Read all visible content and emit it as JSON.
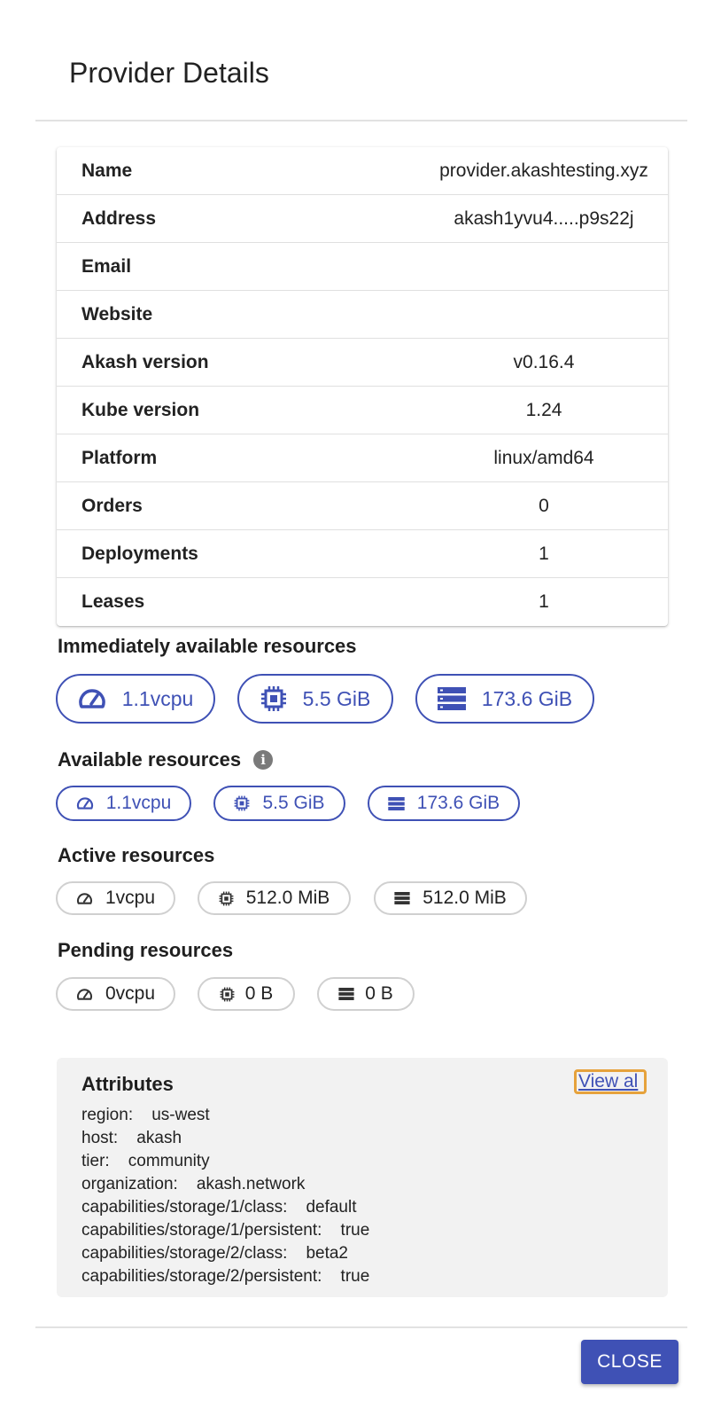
{
  "dialog": {
    "title": "Provider Details",
    "close_label": "CLOSE"
  },
  "info_rows": [
    {
      "label": "Name",
      "value": "provider.akashtesting.xyz"
    },
    {
      "label": "Address",
      "value": "akash1yvu4.....p9s22j"
    },
    {
      "label": "Email",
      "value": ""
    },
    {
      "label": "Website",
      "value": ""
    },
    {
      "label": "Akash version",
      "value": "v0.16.4"
    },
    {
      "label": "Kube version",
      "value": "1.24"
    },
    {
      "label": "Platform",
      "value": "linux/amd64"
    },
    {
      "label": "Orders",
      "value": "0"
    },
    {
      "label": "Deployments",
      "value": "1"
    },
    {
      "label": "Leases",
      "value": "1"
    }
  ],
  "immediate": {
    "title": "Immediately available resources",
    "cpu": "1.1vcpu",
    "memory": "5.5 GiB",
    "storage": "173.6 GiB"
  },
  "available": {
    "title": "Available resources",
    "cpu": "1.1vcpu",
    "memory": "5.5 GiB",
    "storage": "173.6 GiB",
    "info_icon": "i"
  },
  "active": {
    "title": "Active resources",
    "cpu": "1vcpu",
    "memory": "512.0 MiB",
    "storage": "512.0 MiB"
  },
  "pending": {
    "title": "Pending resources",
    "cpu": "0vcpu",
    "memory": "0 B",
    "storage": "0 B"
  },
  "attributes": {
    "title": "Attributes",
    "view_all": "View al",
    "items": [
      "region:    us-west",
      "host:    akash",
      "tier:    community",
      "organization:    akash.network",
      "capabilities/storage/1/class:    default",
      "capabilities/storage/1/persistent:    true",
      "capabilities/storage/2/class:    beta2",
      "capabilities/storage/2/persistent:    true"
    ]
  },
  "colors": {
    "accent": "#3f51b5",
    "focus_outline": "#e6a23c",
    "attributes_bg": "#f2f2f2"
  },
  "icons": {
    "cpu": "speedometer-icon",
    "memory": "chip-icon",
    "storage": "storage-icon",
    "info": "info-icon"
  }
}
